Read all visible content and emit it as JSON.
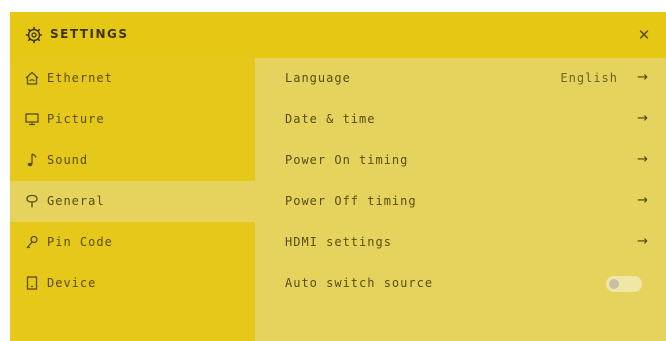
{
  "header": {
    "title": "SETTINGS",
    "icon": "gear-icon",
    "close_symbol": "✕"
  },
  "sidebar": {
    "items": [
      {
        "label": "Ethernet",
        "icon": "home-network-icon",
        "active": false
      },
      {
        "label": "Picture",
        "icon": "monitor-icon",
        "active": false
      },
      {
        "label": "Sound",
        "icon": "music-note-icon",
        "active": false
      },
      {
        "label": "General",
        "icon": "general-settings-icon",
        "active": true
      },
      {
        "label": "Pin Code",
        "icon": "key-icon",
        "active": false
      },
      {
        "label": "Device",
        "icon": "device-icon",
        "active": false
      }
    ]
  },
  "content": {
    "rows": [
      {
        "label": "Language",
        "value": "English",
        "arrow": "→"
      },
      {
        "label": "Date & time",
        "arrow": "→"
      },
      {
        "label": "Power On timing",
        "arrow": "→"
      },
      {
        "label": "Power Off timing",
        "arrow": "→"
      },
      {
        "label": "HDMI settings",
        "arrow": "→"
      },
      {
        "label": "Auto switch source",
        "toggle": false
      }
    ]
  },
  "colors": {
    "header": "#e6c814",
    "sidebar": "#e6c81a",
    "content": "#e5d35d",
    "text": "#5a4d10"
  }
}
